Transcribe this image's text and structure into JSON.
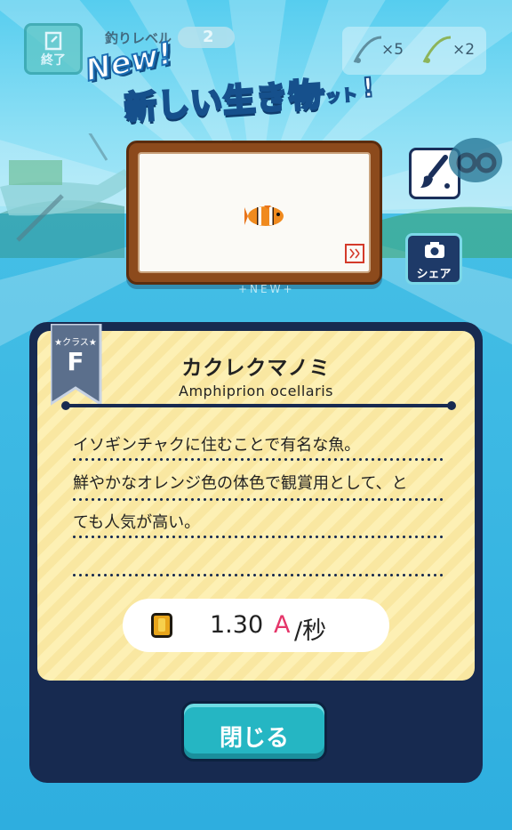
{
  "hud": {
    "exit_label": "終了",
    "level_label": "釣りレベル",
    "level_value": "2",
    "items": [
      {
        "icon": "fishing-rod-icon",
        "count": "×5"
      },
      {
        "icon": "golden-rod-icon",
        "count": "×2"
      }
    ]
  },
  "banner": {
    "new_label": "New!",
    "title": "新しい生き物",
    "suffix": "ゲット",
    "exclaim": "!"
  },
  "catch": {
    "fish_icon": "clownfish-icon",
    "stamp_icon": "red-seal-stamp"
  },
  "side_buttons": {
    "share_label": "シェア"
  },
  "new_tag": "+NEW+",
  "card": {
    "class_label": "★クラス★",
    "class_value": "F",
    "name": "カクレクマノミ",
    "scientific_name": "Amphiprion ocellaris",
    "description": [
      "イソギンチャクに住むことで有名な魚。",
      "鮮やかなオレンジ色の体色で観賞用として、と",
      "ても人気が高い。"
    ],
    "rate_value": "1.30",
    "rate_unit": "A",
    "rate_per": "/秒",
    "close_label": "閉じる"
  },
  "colors": {
    "sea": "#47c3e8",
    "card_navy": "#172a50",
    "paper": "#fdf0b4",
    "close_button": "#25b6c3",
    "rate_unit": "#e5366a"
  }
}
